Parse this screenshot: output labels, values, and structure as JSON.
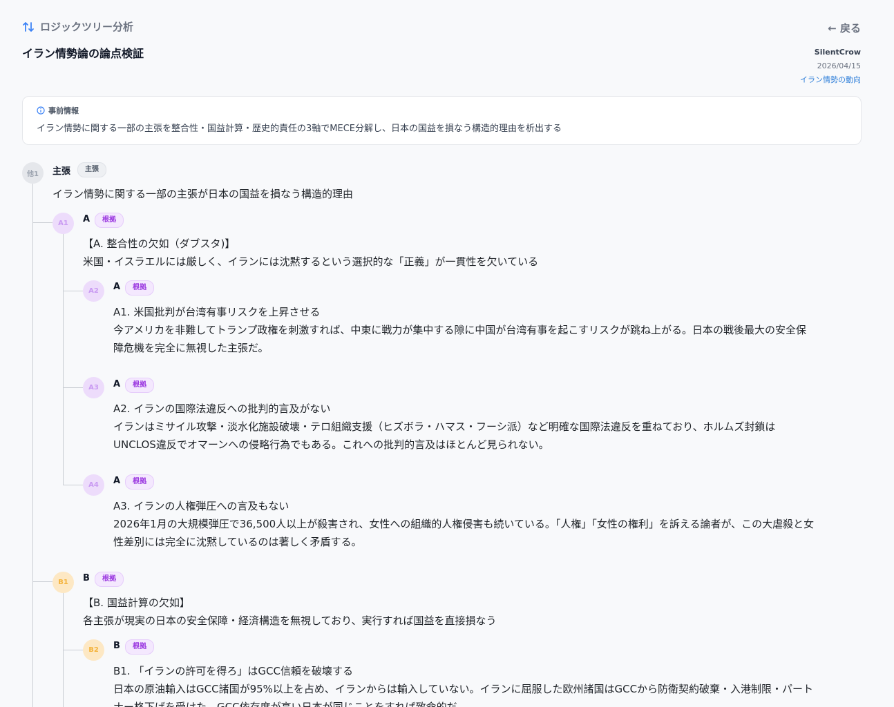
{
  "header": {
    "section_title": "ロジックツリー分析",
    "back_label": "← 戻る",
    "page_title": "イラン情勢論の論点検証",
    "author": "SilentCrow",
    "date": "2026/04/15",
    "topic_link": "イラン情勢の動向"
  },
  "info": {
    "heading": "事前情報",
    "text": "イラン情勢に関する一部の主張を整合性・国益計算・歴史的責任の3軸でMECE分解し、日本の国益を損なう構造的理由を析出する"
  },
  "colors": {
    "link": "#2f7fd9",
    "purple": "#9a36e0",
    "orange": "#f4b33c"
  },
  "tree": {
    "root": {
      "id": "他1",
      "label": "主張",
      "badge": "主張",
      "text": "イラン情勢に関する一部の主張が日本の国益を損なう構造的理由"
    },
    "a1": {
      "id": "A1",
      "label": "A",
      "badge": "根拠",
      "line1": "【A. 整合性の欠如（ダブスタ)】",
      "line2": "米国・イスラエルには厳しく、イランには沈黙するという選択的な「正義」が一貫性を欠いている"
    },
    "a2": {
      "id": "A2",
      "label": "A",
      "badge": "根拠",
      "line1": "A1. 米国批判が台湾有事リスクを上昇させる",
      "line2": "今アメリカを非難してトランプ政権を刺激すれば、中東に戦力が集中する隙に中国が台湾有事を起こすリスクが跳ね上がる。日本の戦後最大の安全保",
      "line3": "障危機を完全に無視した主張だ。"
    },
    "a3": {
      "id": "A3",
      "label": "A",
      "badge": "根拠",
      "line1": "A2. イランの国際法違反への批判的言及がない",
      "line2": "イランはミサイル攻撃・淡水化施設破壊・テロ組織支援（ヒズボラ・ハマス・フーシ派）など明確な国際法違反を重ねており、ホルムズ封鎖は",
      "line3": "UNCLOS違反でオマーンへの侵略行為でもある。これへの批判的言及はほとんど見られない。"
    },
    "a4": {
      "id": "A4",
      "label": "A",
      "badge": "根拠",
      "line1": "A3. イランの人権弾圧への言及もない",
      "line2": "2026年1月の大規模弾圧で36,500人以上が殺害され、女性への組織的人権侵害も続いている。「人権」「女性の権利」を訴える論者が、この大虐殺と女",
      "line3": "性差別には完全に沈黙しているのは著しく矛盾する。"
    },
    "b1": {
      "id": "B1",
      "label": "B",
      "badge": "根拠",
      "line1": "【B. 国益計算の欠如】",
      "line2": "各主張が現実の日本の安全保障・経済構造を無視しており、実行すれば国益を直接損なう"
    },
    "b2": {
      "id": "B2",
      "label": "B",
      "badge": "根拠",
      "line1": "B1. 「イランの許可を得ろ」はGCC信頼を破壊する",
      "line2": "日本の原油輸入はGCC諸国が95%以上を占め、イランからは輸入していない。イランに屈服した欧州諸国はGCCから防衛契約破棄・入港制限・パート",
      "line3": "ナー格下げを受けた。GCC依存度が高い日本が同じことをすれば致命的だ。"
    }
  }
}
